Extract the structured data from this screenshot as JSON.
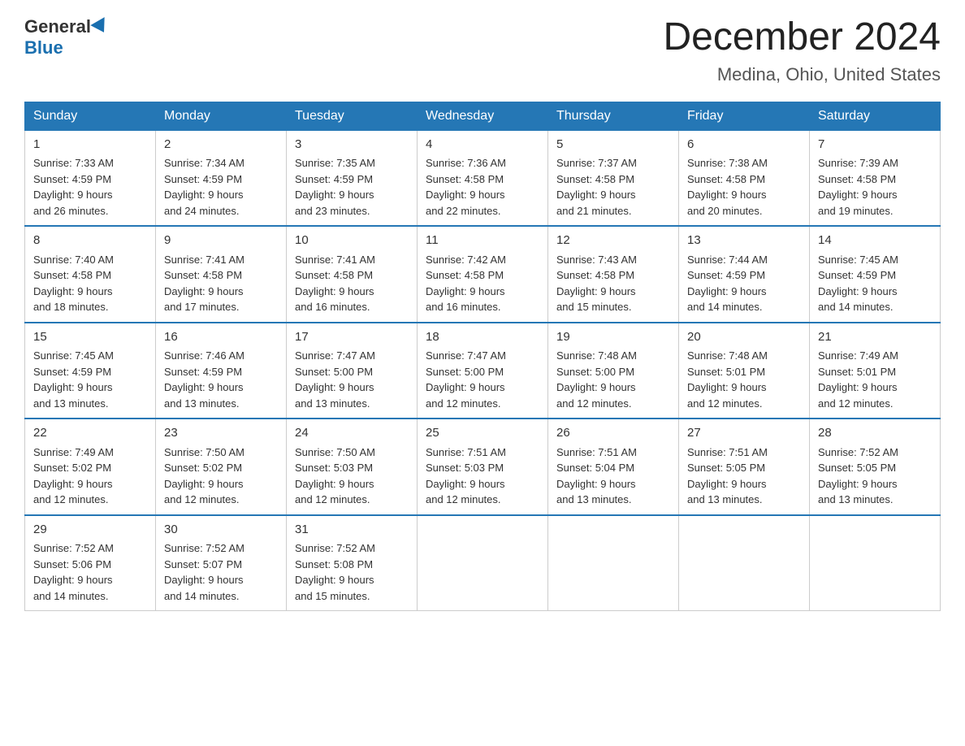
{
  "header": {
    "logo_general": "General",
    "logo_blue": "Blue",
    "month_title": "December 2024",
    "location": "Medina, Ohio, United States"
  },
  "days_of_week": [
    "Sunday",
    "Monday",
    "Tuesday",
    "Wednesday",
    "Thursday",
    "Friday",
    "Saturday"
  ],
  "weeks": [
    [
      {
        "day": "1",
        "sunrise": "7:33 AM",
        "sunset": "4:59 PM",
        "daylight": "9 hours and 26 minutes."
      },
      {
        "day": "2",
        "sunrise": "7:34 AM",
        "sunset": "4:59 PM",
        "daylight": "9 hours and 24 minutes."
      },
      {
        "day": "3",
        "sunrise": "7:35 AM",
        "sunset": "4:59 PM",
        "daylight": "9 hours and 23 minutes."
      },
      {
        "day": "4",
        "sunrise": "7:36 AM",
        "sunset": "4:58 PM",
        "daylight": "9 hours and 22 minutes."
      },
      {
        "day": "5",
        "sunrise": "7:37 AM",
        "sunset": "4:58 PM",
        "daylight": "9 hours and 21 minutes."
      },
      {
        "day": "6",
        "sunrise": "7:38 AM",
        "sunset": "4:58 PM",
        "daylight": "9 hours and 20 minutes."
      },
      {
        "day": "7",
        "sunrise": "7:39 AM",
        "sunset": "4:58 PM",
        "daylight": "9 hours and 19 minutes."
      }
    ],
    [
      {
        "day": "8",
        "sunrise": "7:40 AM",
        "sunset": "4:58 PM",
        "daylight": "9 hours and 18 minutes."
      },
      {
        "day": "9",
        "sunrise": "7:41 AM",
        "sunset": "4:58 PM",
        "daylight": "9 hours and 17 minutes."
      },
      {
        "day": "10",
        "sunrise": "7:41 AM",
        "sunset": "4:58 PM",
        "daylight": "9 hours and 16 minutes."
      },
      {
        "day": "11",
        "sunrise": "7:42 AM",
        "sunset": "4:58 PM",
        "daylight": "9 hours and 16 minutes."
      },
      {
        "day": "12",
        "sunrise": "7:43 AM",
        "sunset": "4:58 PM",
        "daylight": "9 hours and 15 minutes."
      },
      {
        "day": "13",
        "sunrise": "7:44 AM",
        "sunset": "4:59 PM",
        "daylight": "9 hours and 14 minutes."
      },
      {
        "day": "14",
        "sunrise": "7:45 AM",
        "sunset": "4:59 PM",
        "daylight": "9 hours and 14 minutes."
      }
    ],
    [
      {
        "day": "15",
        "sunrise": "7:45 AM",
        "sunset": "4:59 PM",
        "daylight": "9 hours and 13 minutes."
      },
      {
        "day": "16",
        "sunrise": "7:46 AM",
        "sunset": "4:59 PM",
        "daylight": "9 hours and 13 minutes."
      },
      {
        "day": "17",
        "sunrise": "7:47 AM",
        "sunset": "5:00 PM",
        "daylight": "9 hours and 13 minutes."
      },
      {
        "day": "18",
        "sunrise": "7:47 AM",
        "sunset": "5:00 PM",
        "daylight": "9 hours and 12 minutes."
      },
      {
        "day": "19",
        "sunrise": "7:48 AM",
        "sunset": "5:00 PM",
        "daylight": "9 hours and 12 minutes."
      },
      {
        "day": "20",
        "sunrise": "7:48 AM",
        "sunset": "5:01 PM",
        "daylight": "9 hours and 12 minutes."
      },
      {
        "day": "21",
        "sunrise": "7:49 AM",
        "sunset": "5:01 PM",
        "daylight": "9 hours and 12 minutes."
      }
    ],
    [
      {
        "day": "22",
        "sunrise": "7:49 AM",
        "sunset": "5:02 PM",
        "daylight": "9 hours and 12 minutes."
      },
      {
        "day": "23",
        "sunrise": "7:50 AM",
        "sunset": "5:02 PM",
        "daylight": "9 hours and 12 minutes."
      },
      {
        "day": "24",
        "sunrise": "7:50 AM",
        "sunset": "5:03 PM",
        "daylight": "9 hours and 12 minutes."
      },
      {
        "day": "25",
        "sunrise": "7:51 AM",
        "sunset": "5:03 PM",
        "daylight": "9 hours and 12 minutes."
      },
      {
        "day": "26",
        "sunrise": "7:51 AM",
        "sunset": "5:04 PM",
        "daylight": "9 hours and 13 minutes."
      },
      {
        "day": "27",
        "sunrise": "7:51 AM",
        "sunset": "5:05 PM",
        "daylight": "9 hours and 13 minutes."
      },
      {
        "day": "28",
        "sunrise": "7:52 AM",
        "sunset": "5:05 PM",
        "daylight": "9 hours and 13 minutes."
      }
    ],
    [
      {
        "day": "29",
        "sunrise": "7:52 AM",
        "sunset": "5:06 PM",
        "daylight": "9 hours and 14 minutes."
      },
      {
        "day": "30",
        "sunrise": "7:52 AM",
        "sunset": "5:07 PM",
        "daylight": "9 hours and 14 minutes."
      },
      {
        "day": "31",
        "sunrise": "7:52 AM",
        "sunset": "5:08 PM",
        "daylight": "9 hours and 15 minutes."
      },
      null,
      null,
      null,
      null
    ]
  ],
  "labels": {
    "sunrise": "Sunrise:",
    "sunset": "Sunset:",
    "daylight": "Daylight:"
  }
}
